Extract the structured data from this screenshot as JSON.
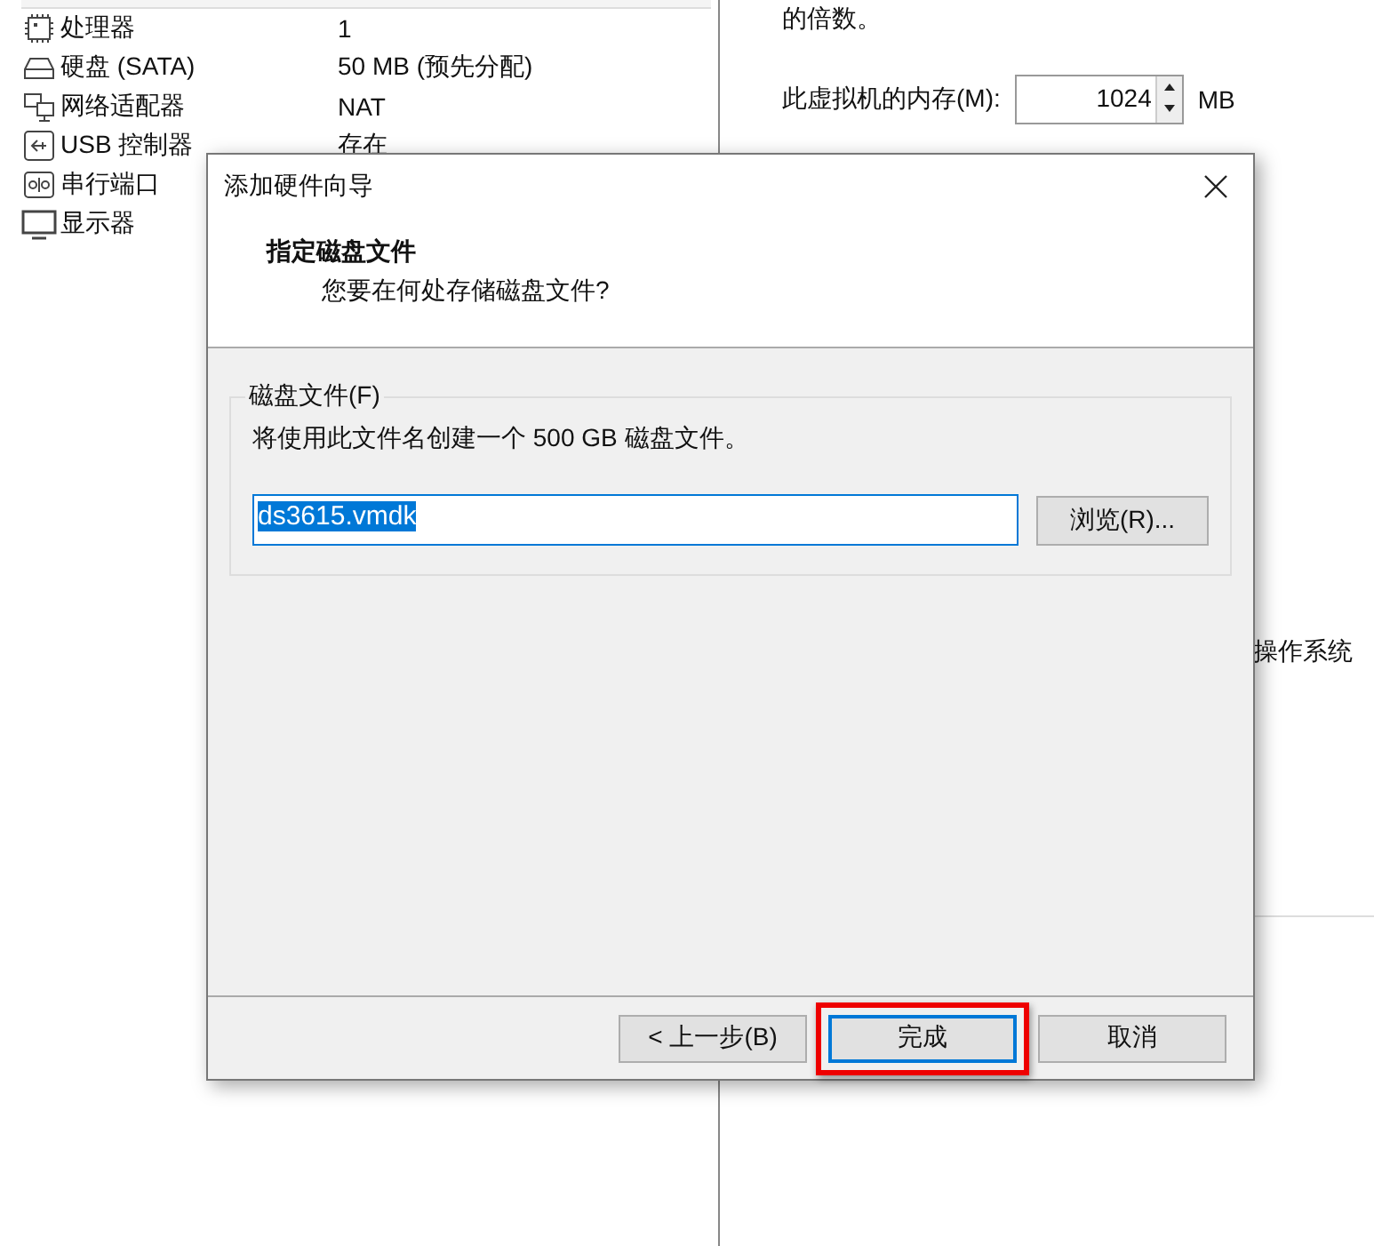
{
  "devices": [
    {
      "name": "处理器",
      "value": "1"
    },
    {
      "name": "硬盘 (SATA)",
      "value": "50 MB (预先分配)"
    },
    {
      "name": "网络适配器",
      "value": "NAT"
    },
    {
      "name": "USB 控制器",
      "value": "存在"
    },
    {
      "name": "串行端口"
    },
    {
      "name": "显示器"
    }
  ],
  "right_pane": {
    "note": "的倍数。",
    "memory": {
      "label": "此虚拟机的内存(M):",
      "value": "1024",
      "unit": "MB"
    },
    "partial_text": "操作系统"
  },
  "dialog": {
    "title": "添加硬件向导",
    "heading": "指定磁盘文件",
    "subheading": "您要在何处存储磁盘文件?",
    "group": {
      "label": "磁盘文件(F)",
      "description": "将使用此文件名创建一个 500 GB 磁盘文件。",
      "file_name": "ds3615.vmdk",
      "browse": "浏览(R)..."
    },
    "buttons": [
      {
        "label": "< 上一步(B)",
        "focused": false,
        "highlighted": false
      },
      {
        "label": "完成",
        "focused": true,
        "highlighted": true
      },
      {
        "label": "取消",
        "focused": false,
        "highlighted": false
      }
    ]
  }
}
